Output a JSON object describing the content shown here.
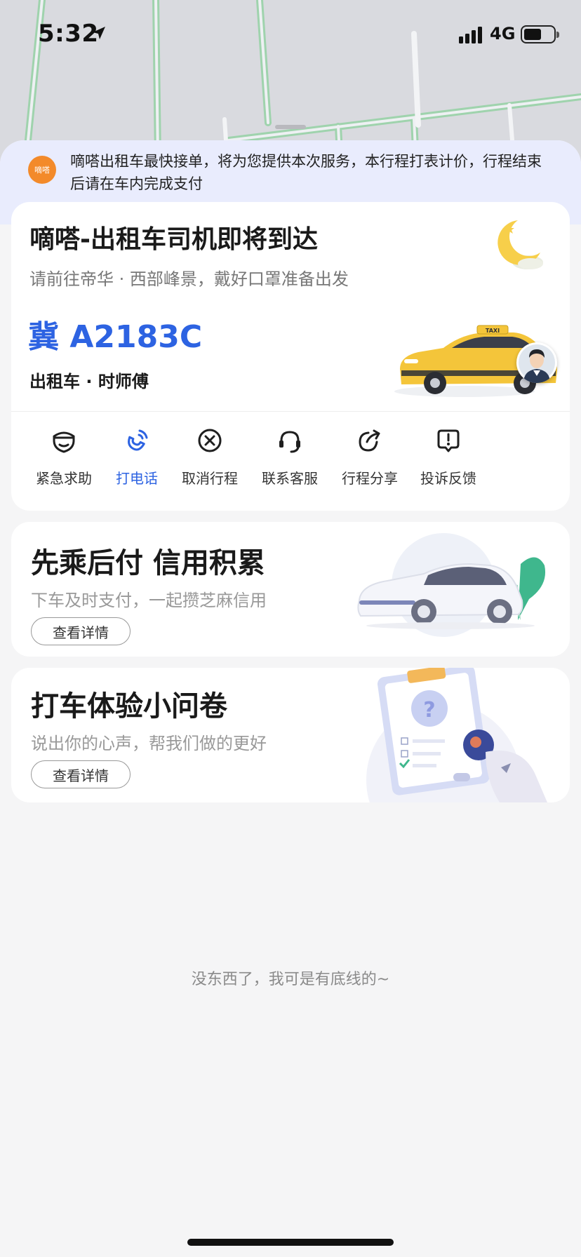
{
  "status_bar": {
    "time": "5:32",
    "network": "4G"
  },
  "notice": {
    "logo_text": "嘀嗒",
    "text": "嘀嗒出租车最快接单，将为您提供本次服务，本行程打表计价，行程结束后请在车内完成支付"
  },
  "driver": {
    "title": "嘀嗒-出租车司机即将到达",
    "subtitle": "请前往帝华 · 西部峰景，戴好口罩准备出发",
    "plate": "冀 A2183C",
    "vehicle_info": "出租车 · 时师傅",
    "taxi_sign": "TAXI"
  },
  "actions": [
    {
      "label": "紧急求助",
      "icon": "shield-icon"
    },
    {
      "label": "打电话",
      "icon": "phone-icon"
    },
    {
      "label": "取消行程",
      "icon": "cancel-icon"
    },
    {
      "label": "联系客服",
      "icon": "headset-icon"
    },
    {
      "label": "行程分享",
      "icon": "share-icon"
    },
    {
      "label": "投诉反馈",
      "icon": "feedback-icon"
    }
  ],
  "promos": [
    {
      "title": "先乘后付 信用积累",
      "subtitle": "下车及时支付，一起攒芝麻信用",
      "button": "查看详情"
    },
    {
      "title": "打车体验小问卷",
      "subtitle": "说出你的心声，帮我们做的更好",
      "button": "查看详情"
    }
  ],
  "footer": "没东西了，我可是有底线的~",
  "colors": {
    "accent": "#2d63e2",
    "notice_bg": "#e9ecfd",
    "logo": "#f38a2a",
    "map_road": "#9fd3ad"
  }
}
